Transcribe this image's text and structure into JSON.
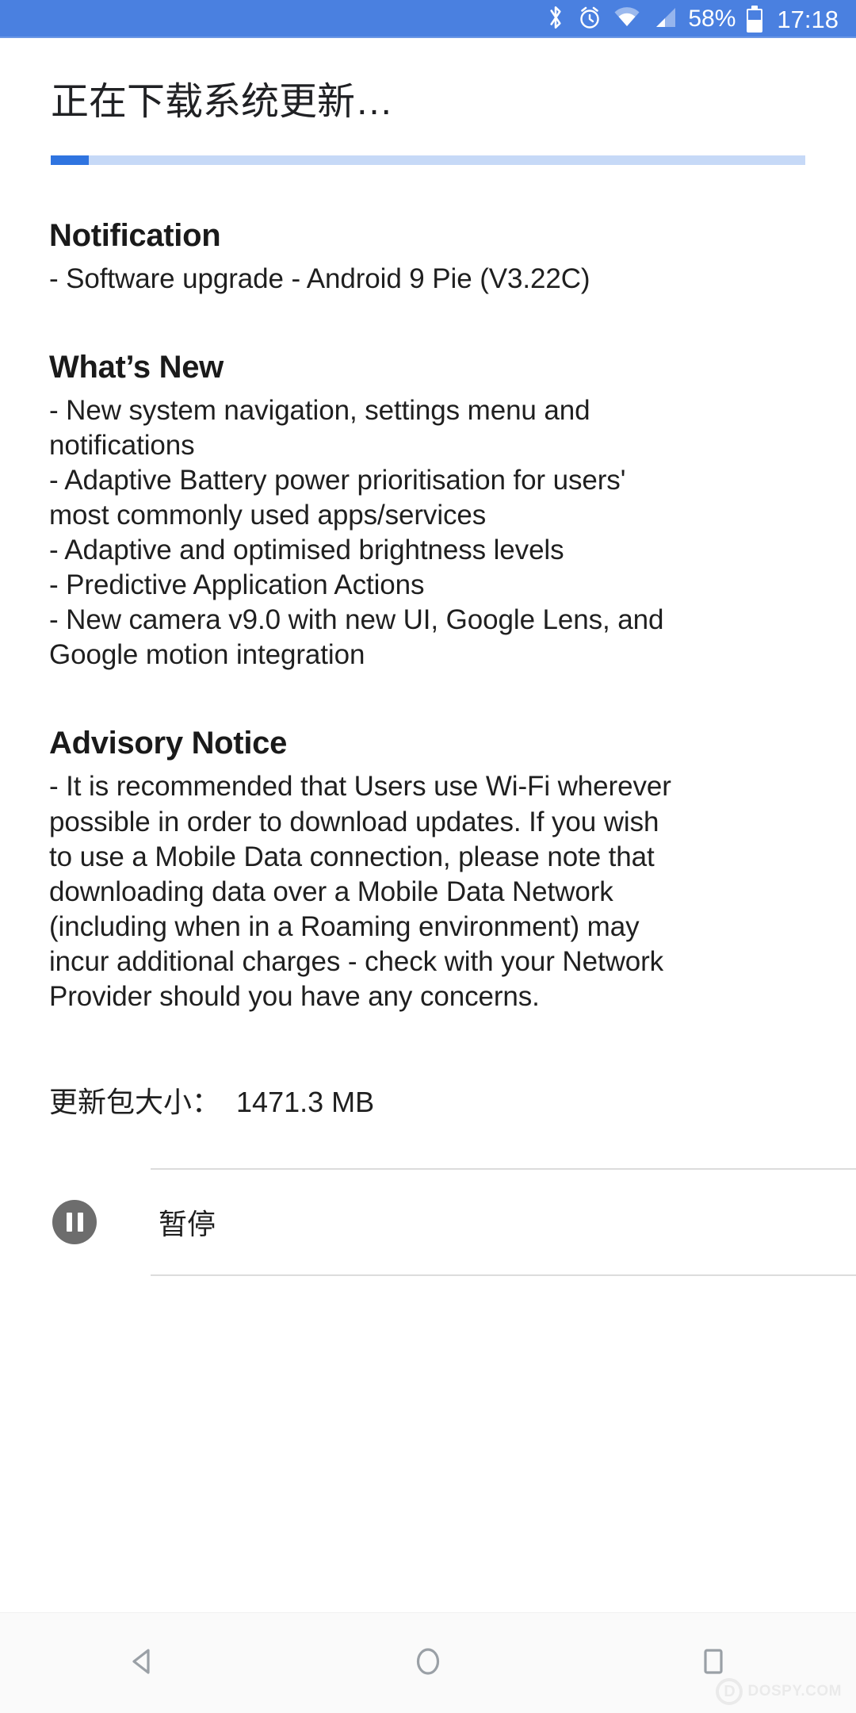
{
  "status_bar": {
    "background_color": "#4a80e0",
    "icons": [
      "bluetooth-icon",
      "alarm-icon",
      "wifi-icon",
      "signal-icon"
    ],
    "battery_percent_label": "58%",
    "time_label": "17:18"
  },
  "header": {
    "title": "正在下载系统更新…"
  },
  "progress": {
    "percent": 5,
    "fill_color": "#2f74e0",
    "track_color": "#c6d9f7"
  },
  "sections": [
    {
      "heading": "Notification",
      "lines": [
        "- Software upgrade - Android 9 Pie (V3.22C)"
      ]
    },
    {
      "heading": "What’s New",
      "lines": [
        "- New system navigation, settings menu and",
        "notifications",
        "- Adaptive Battery power prioritisation for users'",
        "most commonly used apps/services",
        "- Adaptive and optimised brightness levels",
        "- Predictive Application Actions",
        "- New camera v9.0 with new UI, Google Lens, and",
        "Google motion integration"
      ]
    },
    {
      "heading": "Advisory Notice",
      "lines": [
        "- It is recommended that Users use Wi-Fi wherever",
        "possible in order to download updates. If you wish",
        "to use a Mobile Data connection, please note that",
        "downloading data over a Mobile Data Network",
        "(including when in a Roaming environment) may",
        "incur additional charges - check with your Network",
        "Provider should you have any concerns."
      ]
    }
  ],
  "package_size": {
    "label": "更新包大小：",
    "value": "1471.3 MB"
  },
  "action": {
    "icon": "pause-icon",
    "label": "暂停"
  },
  "nav_bar": {
    "back_label": "back-icon",
    "home_label": "home-icon",
    "recents_label": "recents-icon"
  },
  "watermark": {
    "mark": "D",
    "text": "DOSPY.COM"
  }
}
